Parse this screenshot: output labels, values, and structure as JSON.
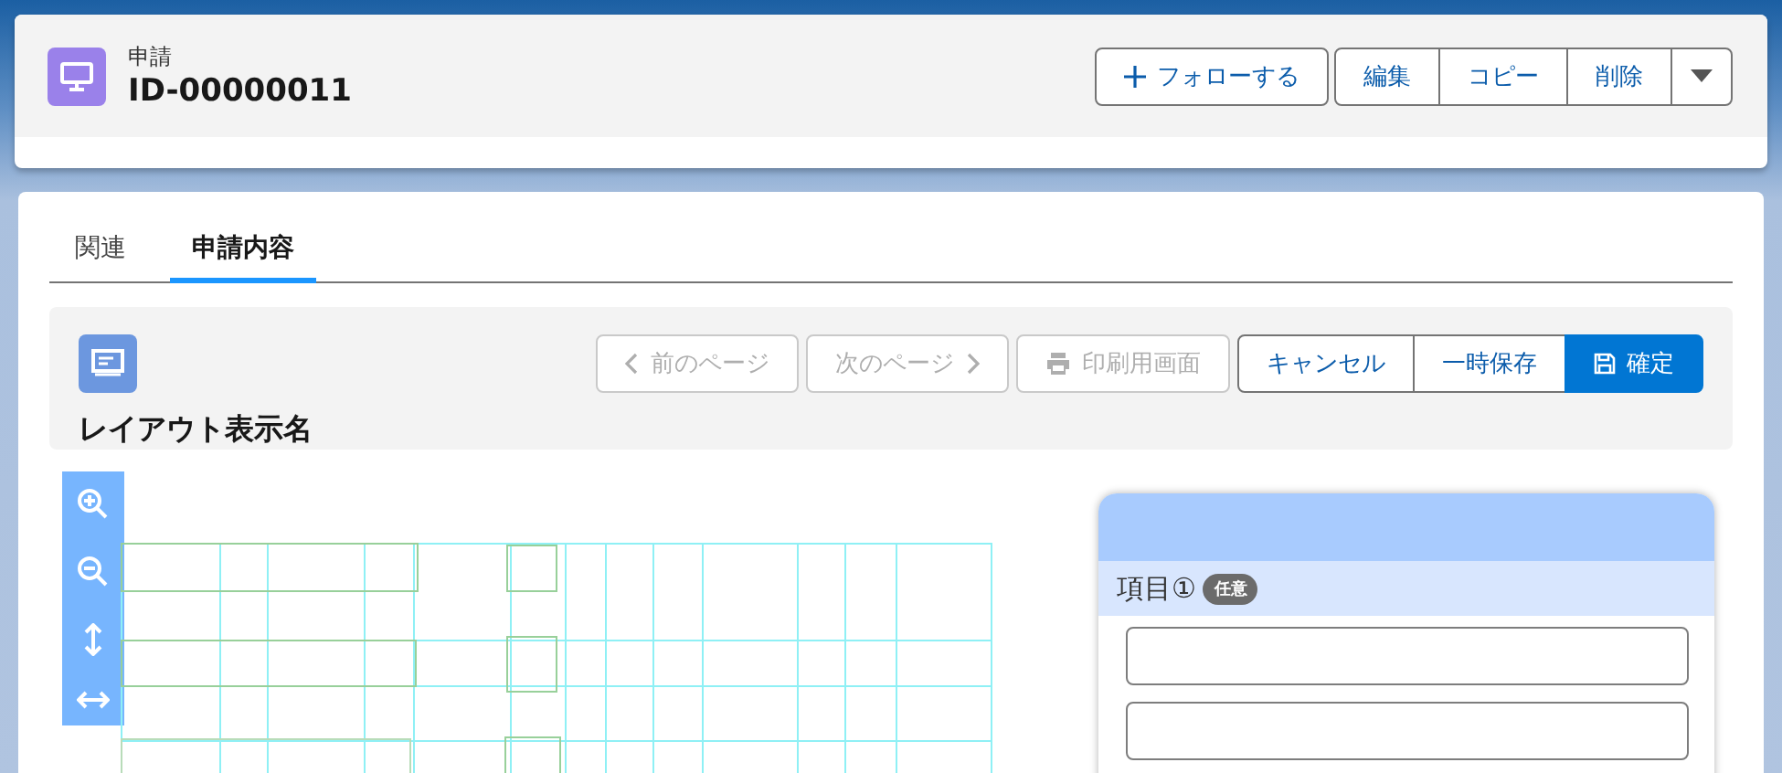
{
  "header": {
    "object_label": "申請",
    "record_id": "ID-00000011",
    "follow_button": "フォローする",
    "actions": [
      "編集",
      "コピー",
      "削除"
    ]
  },
  "tabs": [
    {
      "label": "関連",
      "selected": false
    },
    {
      "label": "申請内容",
      "selected": true
    }
  ],
  "toolbar": {
    "title": "レイアウト表示名",
    "buttons": [
      {
        "kind": "prev",
        "label": "前のページ",
        "disabled": true
      },
      {
        "kind": "next",
        "label": "次のページ",
        "disabled": true
      },
      {
        "kind": "print",
        "label": "印刷用画面",
        "disabled": true
      },
      {
        "kind": "plain",
        "label": "キャンセル",
        "disabled": false
      },
      {
        "kind": "plain",
        "label": "一時保存",
        "disabled": false
      },
      {
        "kind": "primary",
        "label": "確定",
        "disabled": false
      }
    ]
  },
  "field_panel": {
    "label": "項目①",
    "badge": "任意",
    "inputs": [
      {
        "kind": "text"
      },
      {
        "kind": "text"
      }
    ]
  }
}
